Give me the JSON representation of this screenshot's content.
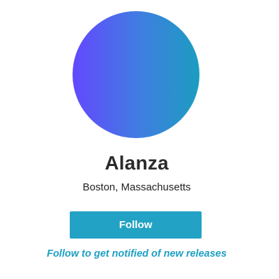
{
  "profile": {
    "name": "Alanza",
    "location": "Boston, Massachusetts",
    "avatar_gradient": [
      "#6348fe",
      "#1b9dc0"
    ]
  },
  "follow": {
    "button_label": "Follow",
    "hint": "Follow to get notified of new releases",
    "button_color": "#22a2c4",
    "hint_color": "#1e9fc2"
  }
}
